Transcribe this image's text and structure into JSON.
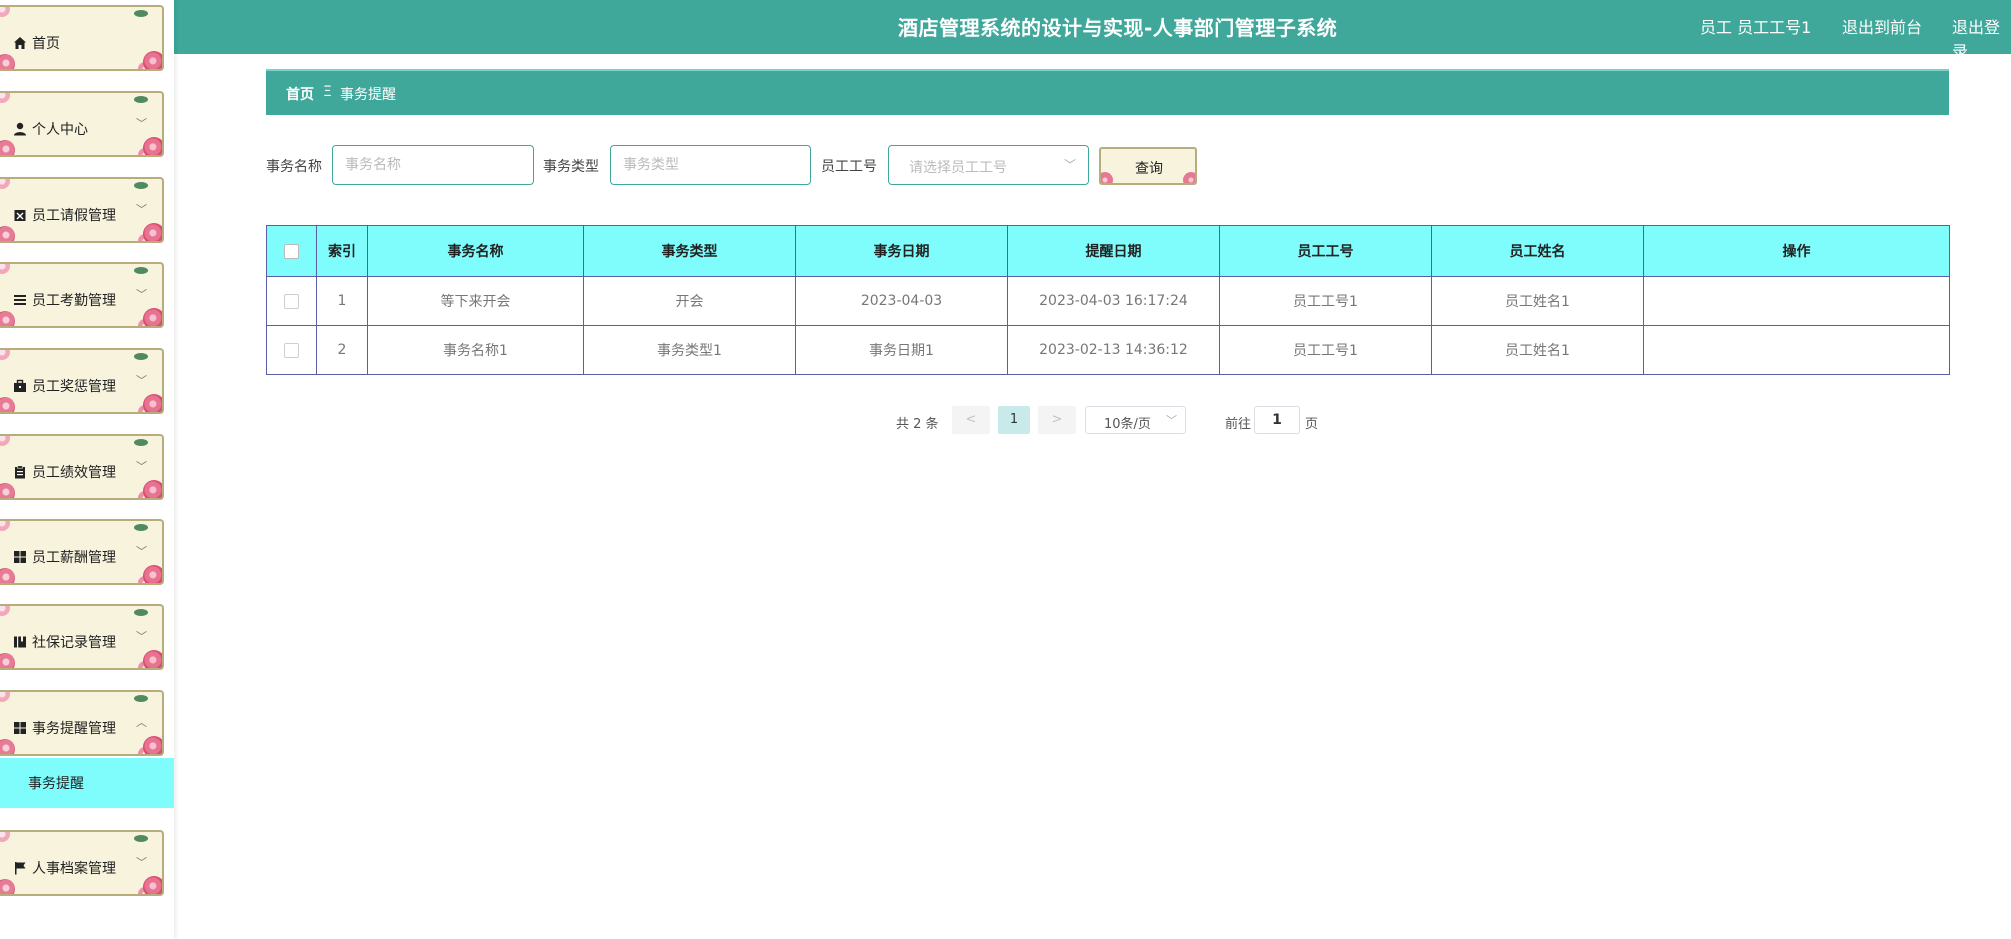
{
  "header": {
    "title": "酒店管理系统的设计与实现-人事部门管理子系统",
    "user": "员工 员工工号1",
    "front_link": "退出到前台",
    "logout_link": "退出登录"
  },
  "sidebar": {
    "items": [
      {
        "label": "首页",
        "icon": "home-icon",
        "chevron": ""
      },
      {
        "label": "个人中心",
        "icon": "user-icon",
        "chevron": "﹀"
      },
      {
        "label": "员工请假管理",
        "icon": "calendar-icon",
        "chevron": "﹀"
      },
      {
        "label": "员工考勤管理",
        "icon": "list-icon",
        "chevron": "﹀"
      },
      {
        "label": "员工奖惩管理",
        "icon": "briefcase-icon",
        "chevron": "﹀"
      },
      {
        "label": "员工绩效管理",
        "icon": "clipboard-icon",
        "chevron": "﹀"
      },
      {
        "label": "员工薪酬管理",
        "icon": "grid-icon",
        "chevron": "﹀"
      },
      {
        "label": "社保记录管理",
        "icon": "book-icon",
        "chevron": "﹀"
      },
      {
        "label": "事务提醒管理",
        "icon": "grid-icon",
        "chevron": "︿"
      },
      {
        "label": "人事档案管理",
        "icon": "flag-icon",
        "chevron": "﹀"
      }
    ],
    "submenu_label": "事务提醒"
  },
  "breadcrumb": {
    "home": "首页",
    "separator": "Ξ",
    "current": "事务提醒"
  },
  "search": {
    "name_label": "事务名称",
    "name_placeholder": "事务名称",
    "type_label": "事务类型",
    "type_placeholder": "事务类型",
    "emp_label": "员工工号",
    "emp_placeholder": "请选择员工工号",
    "button": "查询"
  },
  "table": {
    "headers": [
      "索引",
      "事务名称",
      "事务类型",
      "事务日期",
      "提醒日期",
      "员工工号",
      "员工姓名",
      "操作"
    ],
    "rows": [
      [
        "1",
        "等下来开会",
        "开会",
        "2023-04-03",
        "2023-04-03 16:17:24",
        "员工工号1",
        "员工姓名1",
        ""
      ],
      [
        "2",
        "事务名称1",
        "事务类型1",
        "事务日期1",
        "2023-02-13 14:36:12",
        "员工工号1",
        "员工姓名1",
        ""
      ]
    ]
  },
  "pagination": {
    "total": "共 2 条",
    "prev": "<",
    "page": "1",
    "next": ">",
    "page_size": "10条/页",
    "goto_label": "前往",
    "goto_value": "1",
    "page_suffix": "页"
  },
  "colors": {
    "primary": "#3fa89b",
    "table_header": "#7ffdfd",
    "menu_bg": "#f7f3dd",
    "table_border": "#5b5ea6"
  }
}
